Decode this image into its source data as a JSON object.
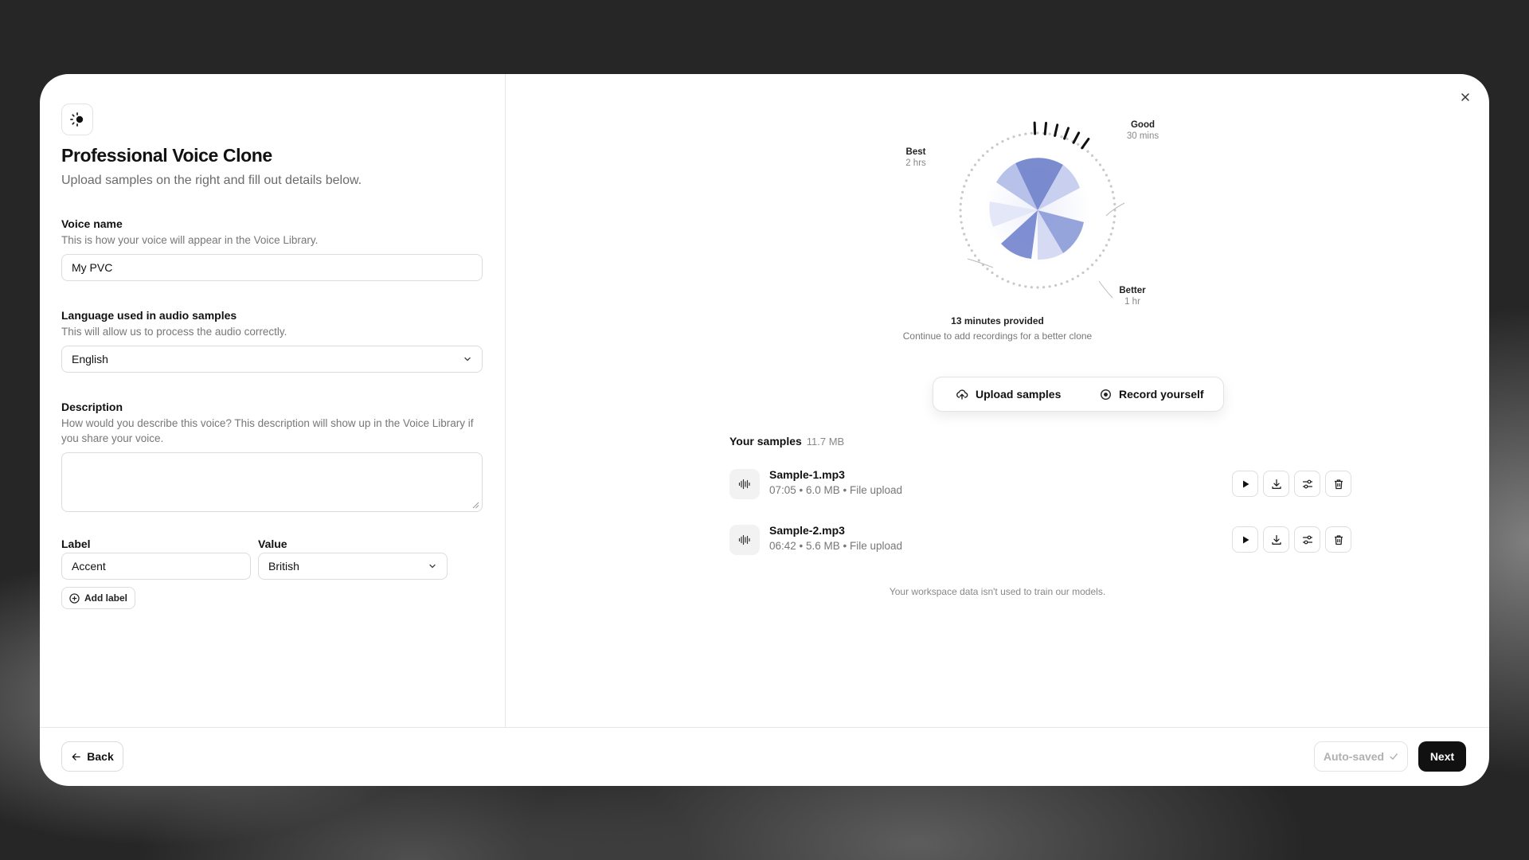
{
  "dialog": {
    "title": "Professional Voice Clone",
    "subtitle": "Upload samples on the right and fill out details below."
  },
  "form": {
    "voice_name": {
      "label": "Voice name",
      "help": "This is how your voice will appear in the Voice Library.",
      "value": "My PVC"
    },
    "language": {
      "label": "Language used in audio samples",
      "help": "This will allow us to process the audio correctly.",
      "value": "English"
    },
    "description": {
      "label": "Description",
      "help": "How would you describe this voice? This description will show up in the Voice Library if you share your voice.",
      "value": ""
    },
    "labels": {
      "label_header": "Label",
      "value_header": "Value",
      "label_value": "Accent",
      "value_value": "British",
      "add_label": "Add label"
    }
  },
  "gauge": {
    "best_label": "Best",
    "best_sub": "2 hrs",
    "good_label": "Good",
    "good_sub": "30 mins",
    "better_label": "Better",
    "better_sub": "1 hr",
    "provided_title": "13 minutes provided",
    "provided_sub": "Continue to add recordings for a better clone"
  },
  "actions": {
    "upload": "Upload samples",
    "record": "Record yourself"
  },
  "samples": {
    "header": "Your samples",
    "total_size": "11.7 MB",
    "items": [
      {
        "name": "Sample-1.mp3",
        "meta": "07:05 • 6.0 MB • File upload"
      },
      {
        "name": "Sample-2.mp3",
        "meta": "06:42 • 5.6 MB • File upload"
      }
    ]
  },
  "disclaimer": "Your workspace data isn't used to train our models.",
  "footer": {
    "back": "Back",
    "autosaved": "Auto-saved",
    "next": "Next"
  },
  "icons": {
    "logo": "spinner-logo-icon",
    "close": "close-icon",
    "chevron": "chevron-down-icon",
    "upload": "cloud-upload-icon",
    "record": "record-icon",
    "waveform": "waveform-icon",
    "play": "play-icon",
    "download": "download-icon",
    "settings": "sliders-icon",
    "delete": "trash-icon",
    "add": "plus-circle-icon",
    "back": "arrow-left-icon",
    "check": "check-icon"
  },
  "colors": {
    "primary_button": "#111111",
    "accent_pie": "#7c8fd4"
  }
}
